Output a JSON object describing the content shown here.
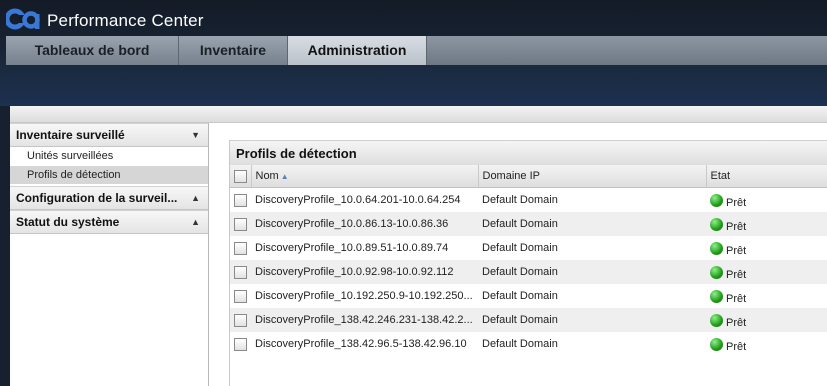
{
  "app": {
    "logo_text": "ca",
    "title": "Performance Center"
  },
  "tabs": [
    {
      "label": "Tableaux de bord",
      "active": false
    },
    {
      "label": "Inventaire",
      "active": false
    },
    {
      "label": "Administration",
      "active": true
    }
  ],
  "sidebar": {
    "sections": [
      {
        "label": "Inventaire surveillé",
        "expanded": true,
        "items": [
          {
            "label": "Unités surveillées",
            "selected": false
          },
          {
            "label": "Profils de détection",
            "selected": true
          }
        ]
      },
      {
        "label": "Configuration de la surveil...",
        "expanded": false
      },
      {
        "label": "Statut du système",
        "expanded": false
      }
    ]
  },
  "panel": {
    "title": "Profils de détection",
    "columns": {
      "name": "Nom",
      "domain": "Domaine IP",
      "status": "Etat"
    },
    "rows": [
      {
        "name": "DiscoveryProfile_10.0.64.201-10.0.64.254",
        "domain": "Default Domain",
        "status": "Prêt"
      },
      {
        "name": "DiscoveryProfile_10.0.86.13-10.0.86.36",
        "domain": "Default Domain",
        "status": "Prêt"
      },
      {
        "name": "DiscoveryProfile_10.0.89.51-10.0.89.74",
        "domain": "Default Domain",
        "status": "Prêt"
      },
      {
        "name": "DiscoveryProfile_10.0.92.98-10.0.92.112",
        "domain": "Default Domain",
        "status": "Prêt"
      },
      {
        "name": "DiscoveryProfile_10.192.250.9-10.192.250...",
        "domain": "Default Domain",
        "status": "Prêt"
      },
      {
        "name": "DiscoveryProfile_138.42.246.231-138.42.2...",
        "domain": "Default Domain",
        "status": "Prêt"
      },
      {
        "name": "DiscoveryProfile_138.42.96.5-138.42.96.10",
        "domain": "Default Domain",
        "status": "Prêt"
      }
    ]
  },
  "colors": {
    "accent_blue": "#3a78d6",
    "status_green": "#1f9a18",
    "header_bg": "#16202f"
  }
}
